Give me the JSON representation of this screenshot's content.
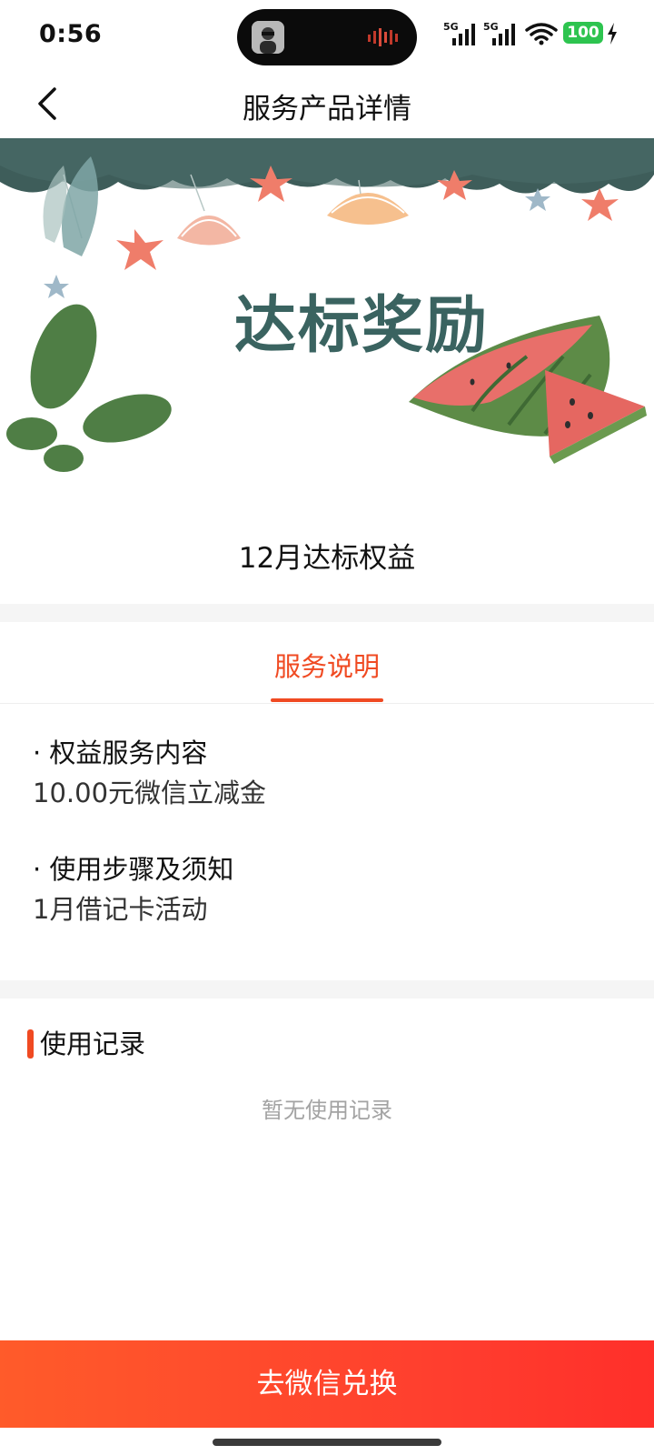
{
  "status_bar": {
    "time": "0:56",
    "network_1": "5G",
    "network_2": "5G",
    "battery": "100"
  },
  "nav": {
    "title": "服务产品详情",
    "back_icon": "chevron-left-icon"
  },
  "banner": {
    "title": "达标奖励"
  },
  "product": {
    "title": "12月达标权益"
  },
  "tabs": [
    {
      "label": "服务说明",
      "active": true
    }
  ],
  "details": [
    {
      "heading": "· 权益服务内容",
      "body": "10.00元微信立减金"
    },
    {
      "heading": "· 使用步骤及须知",
      "body": "1月借记卡活动"
    }
  ],
  "usage": {
    "title": "使用记录",
    "empty": "暂无使用记录"
  },
  "action": {
    "button_label": "去微信兑换"
  },
  "colors": {
    "accent": "#f04a22",
    "button_start": "#ff5b2a",
    "button_end": "#ff2f2a",
    "battery": "#2dc44f"
  }
}
